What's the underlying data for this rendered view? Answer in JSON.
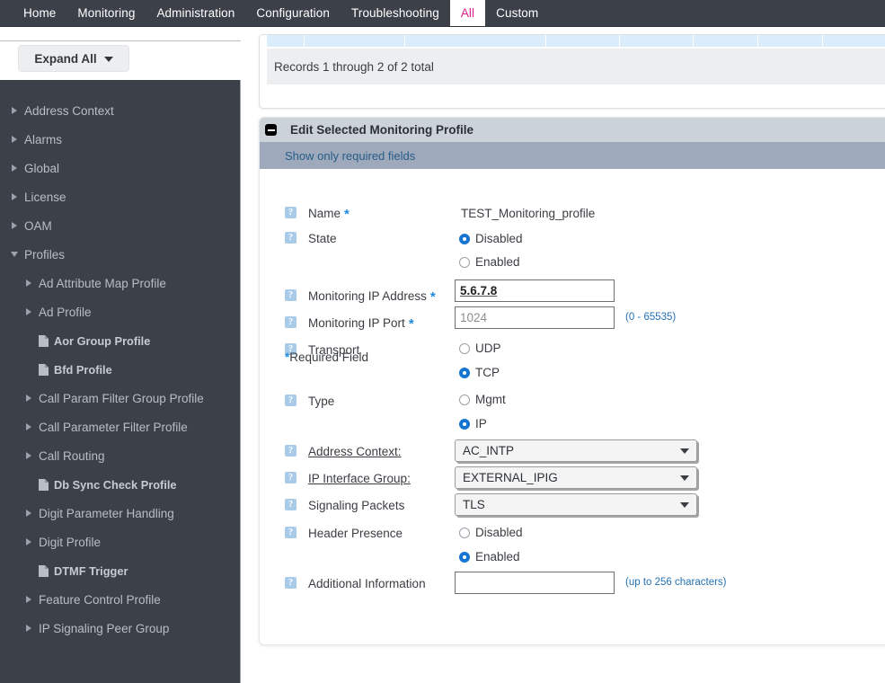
{
  "topnav": {
    "tabs": [
      {
        "label": "Home",
        "active": false
      },
      {
        "label": "Monitoring",
        "active": false
      },
      {
        "label": "Administration",
        "active": false
      },
      {
        "label": "Configuration",
        "active": false
      },
      {
        "label": "Troubleshooting",
        "active": false
      },
      {
        "label": "All",
        "active": true
      },
      {
        "label": "Custom",
        "active": false
      }
    ],
    "active_accent": "#e0218a",
    "background": "#3c4049"
  },
  "sidebar": {
    "expand_all_label": "Expand All",
    "expand_all_icon": "chevron-down-icon",
    "items": [
      {
        "label": "Address Context",
        "level": 1,
        "icon": "triangle-right-icon"
      },
      {
        "label": "Alarms",
        "level": 1,
        "icon": "triangle-right-icon"
      },
      {
        "label": "Global",
        "level": 1,
        "icon": "triangle-right-icon"
      },
      {
        "label": "License",
        "level": 1,
        "icon": "triangle-right-icon"
      },
      {
        "label": "OAM",
        "level": 1,
        "icon": "triangle-right-icon"
      },
      {
        "label": "Profiles",
        "level": 1,
        "icon": "triangle-down-icon"
      },
      {
        "label": "Ad Attribute Map Profile",
        "level": 2,
        "icon": "triangle-right-icon"
      },
      {
        "label": "Ad Profile",
        "level": 2,
        "icon": "triangle-right-icon"
      },
      {
        "label": "Aor Group Profile",
        "level": 2,
        "icon": "document-icon"
      },
      {
        "label": "Bfd Profile",
        "level": 2,
        "icon": "document-icon"
      },
      {
        "label": "Call Param Filter Group Profile",
        "level": 2,
        "icon": "triangle-right-icon"
      },
      {
        "label": "Call Parameter Filter Profile",
        "level": 2,
        "icon": "triangle-right-icon"
      },
      {
        "label": "Call Routing",
        "level": 2,
        "icon": "triangle-right-icon"
      },
      {
        "label": "Db Sync Check Profile",
        "level": 2,
        "icon": "document-icon"
      },
      {
        "label": "Digit Parameter Handling",
        "level": 2,
        "icon": "triangle-right-icon"
      },
      {
        "label": "Digit Profile",
        "level": 2,
        "icon": "triangle-right-icon"
      },
      {
        "label": "DTMF Trigger",
        "level": 2,
        "icon": "document-icon"
      },
      {
        "label": "Feature Control Profile",
        "level": 2,
        "icon": "triangle-right-icon"
      },
      {
        "label": "IP Signaling Peer Group",
        "level": 2,
        "icon": "triangle-right-icon"
      }
    ]
  },
  "grid": {
    "records_text": "Records 1 through 2 of 2 total"
  },
  "editpanel": {
    "title": "Edit Selected Monitoring Profile",
    "collapse_icon": "minus-square-icon",
    "show_required_link": "Show only required fields",
    "required_note": "Required Field",
    "required_star": "*",
    "fields": {
      "name": {
        "label": "Name",
        "required": true,
        "value": "TEST_Monitoring_profile",
        "help_icon": "help-icon"
      },
      "state": {
        "label": "State",
        "required": false,
        "help_icon": "help-icon",
        "options": [
          {
            "label": "Disabled",
            "selected": true
          },
          {
            "label": "Enabled",
            "selected": false
          }
        ]
      },
      "monitoring_ip_address": {
        "label": "Monitoring IP Address",
        "required": true,
        "value": "5.6.7.8",
        "help_icon": "help-icon"
      },
      "monitoring_ip_port": {
        "label": "Monitoring IP Port",
        "required": true,
        "value": "1024",
        "hint": "(0 - 65535)",
        "help_icon": "help-icon"
      },
      "transport": {
        "label": "Transport",
        "required": false,
        "help_icon": "help-icon",
        "options": [
          {
            "label": "UDP",
            "selected": false
          },
          {
            "label": "TCP",
            "selected": true
          }
        ]
      },
      "type": {
        "label": "Type",
        "required": false,
        "help_icon": "help-icon",
        "options": [
          {
            "label": "Mgmt",
            "selected": false
          },
          {
            "label": "IP",
            "selected": true
          }
        ]
      },
      "address_context": {
        "label": "Address Context:",
        "linked": true,
        "value": "AC_INTP",
        "help_icon": "help-icon",
        "caret_icon": "chevron-down-icon"
      },
      "ip_interface_group": {
        "label": "IP Interface Group:",
        "linked": true,
        "value": "EXTERNAL_IPIG",
        "help_icon": "help-icon",
        "caret_icon": "chevron-down-icon"
      },
      "signaling_packets": {
        "label": "Signaling Packets",
        "linked": false,
        "value": "TLS",
        "help_icon": "help-icon",
        "caret_icon": "chevron-down-icon"
      },
      "header_presence": {
        "label": "Header Presence",
        "required": false,
        "help_icon": "help-icon",
        "options": [
          {
            "label": "Disabled",
            "selected": false
          },
          {
            "label": "Enabled",
            "selected": true
          }
        ]
      },
      "additional_information": {
        "label": "Additional Information",
        "required": false,
        "value": "",
        "hint": "(up to 256 characters)",
        "help_icon": "help-icon"
      }
    }
  }
}
